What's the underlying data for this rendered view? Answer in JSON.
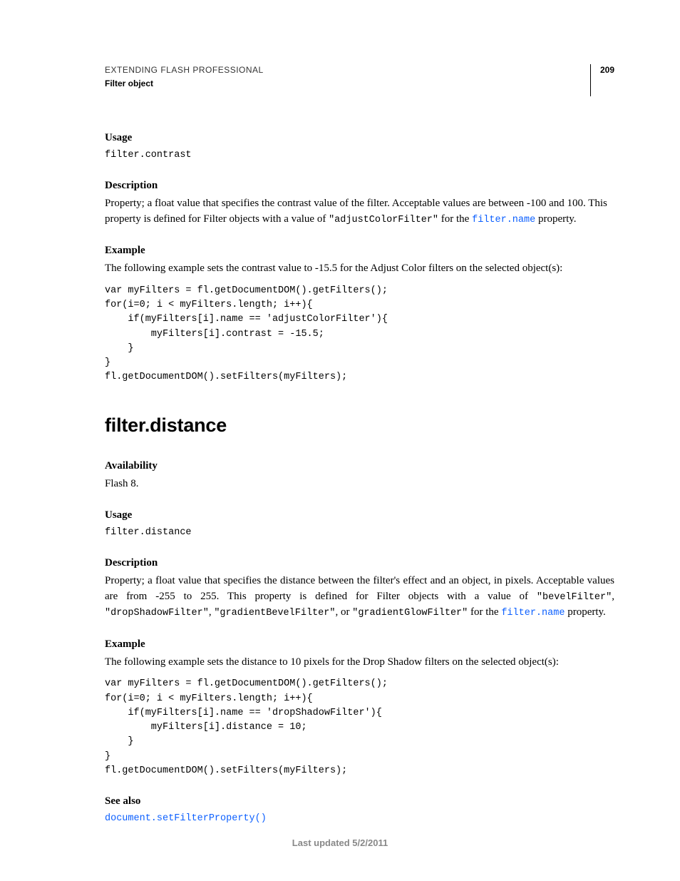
{
  "header": {
    "doc_title": "EXTENDING FLASH PROFESSIONAL",
    "doc_section": "Filter object",
    "page_number": "209"
  },
  "section1": {
    "usage_label": "Usage",
    "usage_code": "filter.contrast",
    "description_label": "Description",
    "description_before": "Property; a float value that specifies the contrast value of the filter. Acceptable values are between -100 and 100. This property is defined for Filter objects with a value of ",
    "description_code1": "\"adjustColorFilter\"",
    "description_mid": " for the ",
    "description_link": "filter.name",
    "description_after": " property.",
    "example_label": "Example",
    "example_intro": "The following example sets the contrast value to -15.5 for the Adjust Color filters on the selected object(s):",
    "example_code": "var myFilters = fl.getDocumentDOM().getFilters();\nfor(i=0; i < myFilters.length; i++){\n    if(myFilters[i].name == 'adjustColorFilter'){\n        myFilters[i].contrast = -15.5;\n    }\n}\nfl.getDocumentDOM().setFilters(myFilters);"
  },
  "section2": {
    "title": "filter.distance",
    "availability_label": "Availability",
    "availability_text": "Flash 8.",
    "usage_label": "Usage",
    "usage_code": "filter.distance",
    "description_label": "Description",
    "description_before": "Property; a float value that specifies the distance between the filter's effect and an object, in pixels. Acceptable values are from -255 to 255. This property is defined for Filter objects with a value of ",
    "description_code1": "\"bevelFilter\"",
    "description_sep1": ", ",
    "description_code2": "\"dropShadowFilter\"",
    "description_sep2": ", ",
    "description_code3": "\"gradientBevelFilter\"",
    "description_sep3": ", or ",
    "description_code4": "\"gradientGlowFilter\"",
    "description_mid": " for the ",
    "description_link": "filter.name",
    "description_after": " property.",
    "example_label": "Example",
    "example_intro": "The following example sets the distance to 10 pixels for the Drop Shadow filters on the selected object(s):",
    "example_code": "var myFilters = fl.getDocumentDOM().getFilters();\nfor(i=0; i < myFilters.length; i++){\n    if(myFilters[i].name == 'dropShadowFilter'){\n        myFilters[i].distance = 10;\n    }\n}\nfl.getDocumentDOM().setFilters(myFilters);",
    "seealso_label": "See also",
    "seealso_link": "document.setFilterProperty()"
  },
  "footer": "Last updated 5/2/2011"
}
